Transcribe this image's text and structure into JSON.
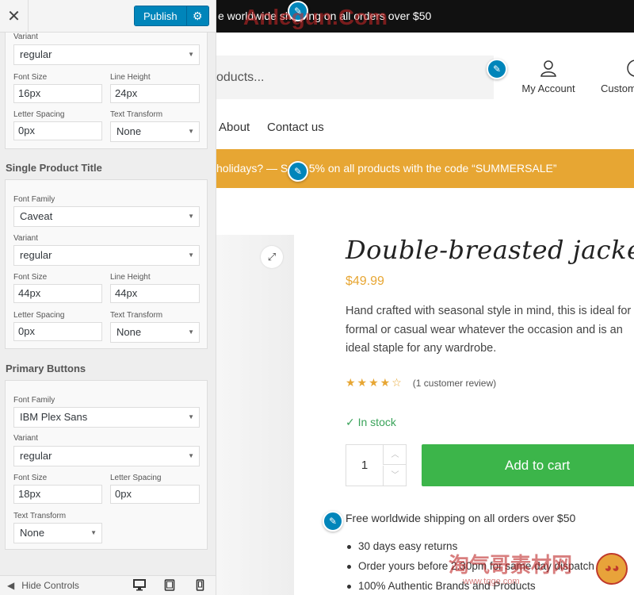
{
  "customizer": {
    "close_glyph": "✕",
    "publish_label": "Publish",
    "gear_glyph": "⚙",
    "hide_controls": "Hide Controls",
    "sections": {
      "top_partial": {
        "variant_label": "Variant",
        "variant_value": "regular",
        "font_size_label": "Font Size",
        "font_size_value": "16px",
        "line_height_label": "Line Height",
        "line_height_value": "24px",
        "letter_spacing_label": "Letter Spacing",
        "letter_spacing_value": "0px",
        "text_transform_label": "Text Transform",
        "text_transform_value": "None"
      },
      "single_product_title": {
        "title": "Single Product Title",
        "font_family_label": "Font Family",
        "font_family_value": "Caveat",
        "variant_label": "Variant",
        "variant_value": "regular",
        "font_size_label": "Font Size",
        "font_size_value": "44px",
        "line_height_label": "Line Height",
        "line_height_value": "44px",
        "letter_spacing_label": "Letter Spacing",
        "letter_spacing_value": "0px",
        "text_transform_label": "Text Transform",
        "text_transform_value": "None"
      },
      "primary_buttons": {
        "title": "Primary Buttons",
        "font_family_label": "Font Family",
        "font_family_value": "IBM Plex Sans",
        "variant_label": "Variant",
        "variant_value": "regular",
        "font_size_label": "Font Size",
        "font_size_value": "18px",
        "letter_spacing_label": "Letter Spacing",
        "letter_spacing_value": "0px",
        "text_transform_label": "Text Transform",
        "text_transform_value": "None"
      }
    }
  },
  "store": {
    "topbar_text": "e worldwide shipping on all orders over $50",
    "search_placeholder": "oducts...",
    "account_label": "My Account",
    "customer_label": "Custom",
    "nav": [
      "About",
      "Contact us"
    ],
    "promo_text": "holidays? — Save 5% on all products with the code “SUMMERSALE”",
    "product": {
      "title": "Double-breasted jacket",
      "price": "$49.99",
      "description": "Hand crafted with seasonal style in mind, this is ideal for formal or casual wear whatever the occasion and is an ideal staple for any wardrobe.",
      "stars": "★★★★☆",
      "rating": 4,
      "review_text": "(1 customer review)",
      "stock": "✓  In stock",
      "quantity": "1",
      "add_to_cart": "Add to cart",
      "shipping_note": "Free worldwide shipping on all orders over $50",
      "features": [
        "30 days easy returns",
        "Order yours before 2.30pm for same day dispatch",
        "100% Authentic Brands and Products"
      ]
    }
  },
  "watermark": {
    "top": "Anlegun.Com",
    "bottom": "淘气哥素材网",
    "bottom_url": "www.tqge.com"
  },
  "colors": {
    "publish": "#0085ba",
    "promo": "#e7a633",
    "add_to_cart": "#3cb54a",
    "in_stock": "#3aa35a"
  }
}
